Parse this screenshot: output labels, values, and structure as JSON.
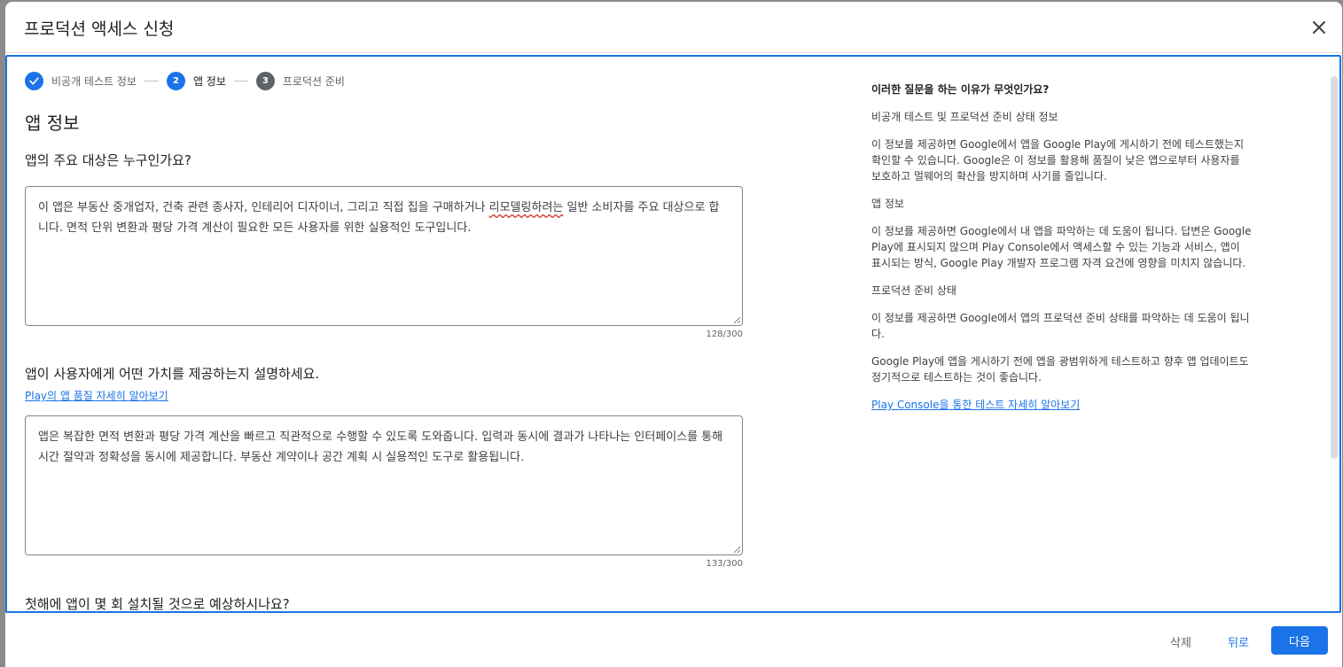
{
  "dialog": {
    "title": "프로덕션 액세스 신청"
  },
  "stepper": {
    "steps": [
      {
        "label": "비공개 테스트 정보",
        "state": "done",
        "number": ""
      },
      {
        "label": "앱 정보",
        "state": "active",
        "number": "2"
      },
      {
        "label": "프로덕션 준비",
        "state": "pending",
        "number": "3"
      }
    ]
  },
  "main": {
    "section_title": "앱 정보",
    "q1": {
      "label": "앱의 주요 대상은 누구인가요?",
      "value_before": "이 앱은 부동산 중개업자, 건축 관련 종사자, 인테리어 디자이너, 그리고 직접 집을 구매하거나 ",
      "value_spell": "리모델링하려는",
      "value_after": " 일반 소비자를 주요 대상으로 합니다. 면적 단위 변환과 평당 가격 계산이 필요한 모든 사용자를 위한 실용적인 도구입니다.",
      "counter": "128/300"
    },
    "q2": {
      "label": "앱이 사용자에게 어떤 가치를 제공하는지 설명하세요.",
      "link": "Play의 앱 품질 자세히 알아보기",
      "value": "앱은 복잡한 면적 변환과 평당 가격 계산을 빠르고 직관적으로 수행할 수 있도록 도와줍니다. 입력과 동시에 결과가 나타나는 인터페이스를 통해 시간 절약과 정확성을 동시에 제공합니다. 부동산 계약이나 공간 계획 시 실용적인 도구로 활용됩니다.",
      "counter": "133/300"
    },
    "q3": {
      "label": "첫해에 앱이 몇 회 설치될 것으로 예상하시나요?"
    }
  },
  "aside": {
    "heading": "이러한 질문을 하는 이유가 무엇인가요?",
    "s1_title": "비공개 테스트 및 프로덕션 준비 상태 정보",
    "s1_body": "이 정보를 제공하면 Google에서 앱을 Google Play에 게시하기 전에 테스트했는지 확인할 수 있습니다. Google은 이 정보를 활용해 품질이 낮은 앱으로부터 사용자를 보호하고 멀웨어의 확산을 방지하며 사기를 줄입니다.",
    "s2_title": "앱 정보",
    "s2_body": "이 정보를 제공하면 Google에서 내 앱을 파악하는 데 도움이 됩니다. 답변은 Google Play에 표시되지 않으며 Play Console에서 액세스할 수 있는 기능과 서비스, 앱이 표시되는 방식, Google Play 개발자 프로그램 자격 요건에 영향을 미치지 않습니다.",
    "s3_title": "프로덕션 준비 상태",
    "s3_body1": "이 정보를 제공하면 Google에서 앱의 프로덕션 준비 상태를 파악하는 데 도움이 됩니다.",
    "s3_body2": "Google Play에 앱을 게시하기 전에 앱을 광범위하게 테스트하고 향후 앱 업데이트도 정기적으로 테스트하는 것이 좋습니다.",
    "link": "Play Console을 통한 테스트 자세히 알아보기"
  },
  "footer": {
    "delete": "삭제",
    "back": "뒤로",
    "next": "다음"
  },
  "colors": {
    "accent": "#1a73e8",
    "text": "#202124",
    "muted": "#5f6368"
  }
}
